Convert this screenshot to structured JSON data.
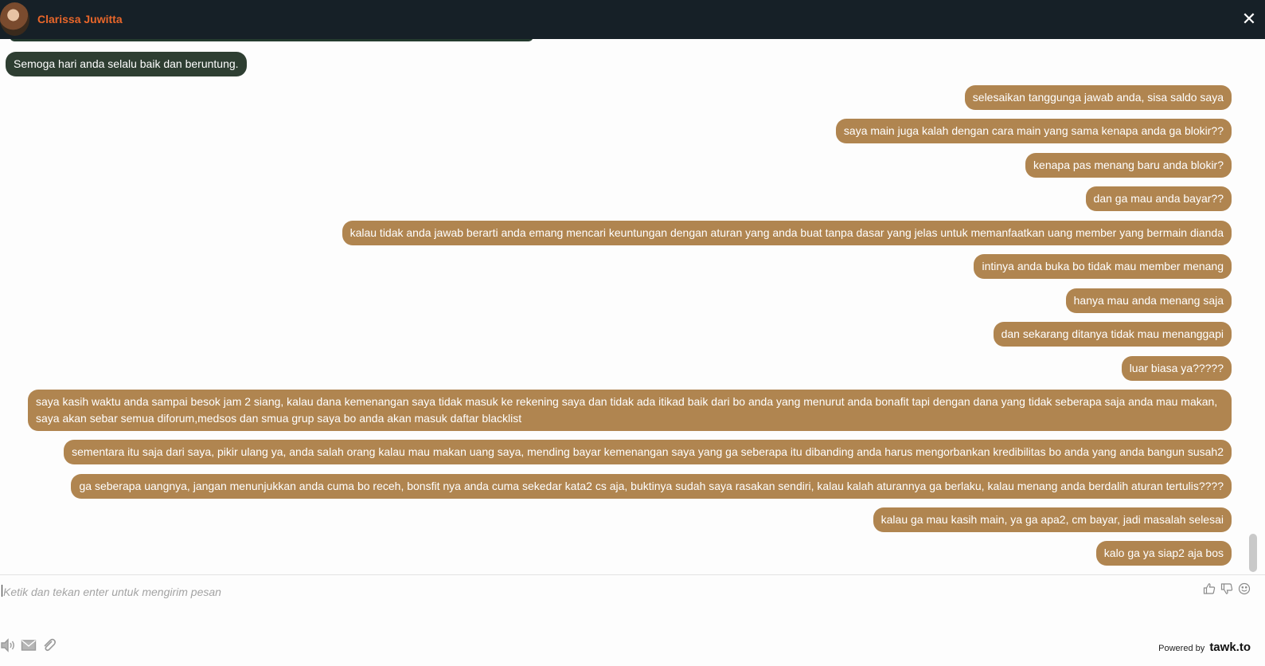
{
  "header": {
    "agent_name": "Clarissa Juwitta",
    "close_glyph": "✕"
  },
  "messages": [
    {
      "side": "in",
      "text": "Semoga hari anda selalu baik dan beruntung."
    },
    {
      "side": "out",
      "text": "selesaikan tanggunga jawab anda, sisa saldo saya"
    },
    {
      "side": "out",
      "text": "saya main juga kalah dengan cara main yang sama kenapa anda ga blokir??"
    },
    {
      "side": "out",
      "text": "kenapa pas menang baru anda blokir?"
    },
    {
      "side": "out",
      "text": "dan ga mau anda bayar??"
    },
    {
      "side": "out",
      "text": "kalau tidak anda jawab berarti anda emang mencari keuntungan dengan aturan yang anda buat tanpa dasar yang jelas untuk memanfaatkan uang member yang bermain dianda"
    },
    {
      "side": "out",
      "text": "intinya anda buka bo tidak mau member menang"
    },
    {
      "side": "out",
      "text": "hanya mau anda menang saja"
    },
    {
      "side": "out",
      "text": "dan sekarang ditanya tidak mau menanggapi"
    },
    {
      "side": "out",
      "text": "luar biasa ya?????"
    },
    {
      "side": "out",
      "text": "saya kasih waktu anda sampai besok jam 2 siang, kalau dana kemenangan saya tidak masuk ke rekening saya dan tidak ada itikad baik dari bo anda yang menurut anda bonafit tapi  dengan dana yang tidak seberapa saja anda mau makan, saya akan sebar semua diforum,medsos dan smua grup saya bo anda akan masuk daftar blacklist"
    },
    {
      "side": "out",
      "text": "sementara itu saja dari saya, pikir ulang ya, anda salah orang kalau mau makan uang saya, mending bayar kemenangan saya yang ga seberapa itu dibanding anda harus mengorbankan kredibilitas bo anda yang anda bangun susah2"
    },
    {
      "side": "out",
      "text": "ga seberapa uangnya, jangan menunjukkan anda cuma bo receh, bonsfit nya anda cuma sekedar kata2 cs aja, buktinya sudah saya rasakan sendiri, kalau kalah aturannya ga berlaku, kalau menang anda berdalih aturan tertulis????"
    },
    {
      "side": "out",
      "text": "kalau ga mau kasih main, ya ga apa2, cm bayar, jadi masalah selesai"
    },
    {
      "side": "out",
      "text": "kalo ga ya siap2 aja bos"
    }
  ],
  "composer": {
    "placeholder": "Ketik dan tekan enter untuk mengirim pesan"
  },
  "toolbar_icons": [
    "thumbs-up-icon",
    "thumbs-down-icon",
    "emoji-icon"
  ],
  "footer_icons": [
    "sound-icon",
    "email-icon",
    "attachment-icon"
  ],
  "footer": {
    "powered_label": "Powered by",
    "brand": "tawk.to"
  },
  "colors": {
    "header_bg": "#162027",
    "agent_name": "#e8662a",
    "incoming_bubble": "#2e3e32",
    "outgoing_bubble": "#b08550"
  }
}
